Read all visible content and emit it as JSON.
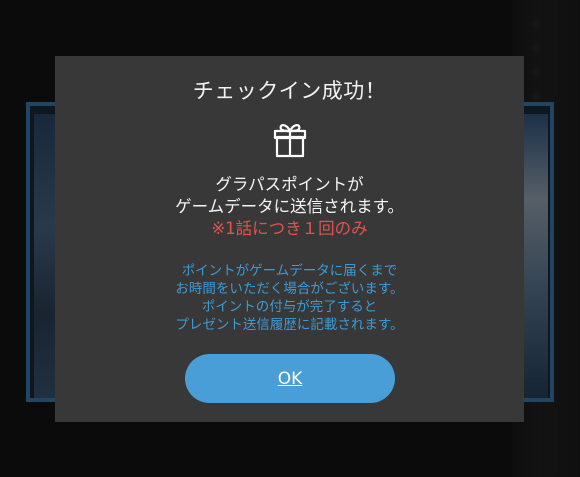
{
  "dialog": {
    "title": "チェックイン成功！",
    "icon": "gift-icon",
    "message_lines": [
      "グラパスポイントが",
      "ゲームデータに送信されます。",
      "※1話につき１回のみ"
    ],
    "note_lines": [
      "ポイントがゲームデータに届くまで",
      "お時間をいただく場合がございます。",
      "ポイントの付与が完了すると",
      "プレゼント送信履歴に記載されます。"
    ],
    "ok_label": "OK"
  },
  "colors": {
    "dialog_bg": "#383838",
    "accent_red": "#e1544c",
    "note_blue": "#3d9ad6",
    "button_blue": "#4a9ed8",
    "frame_blue": "#3c7fb4"
  }
}
